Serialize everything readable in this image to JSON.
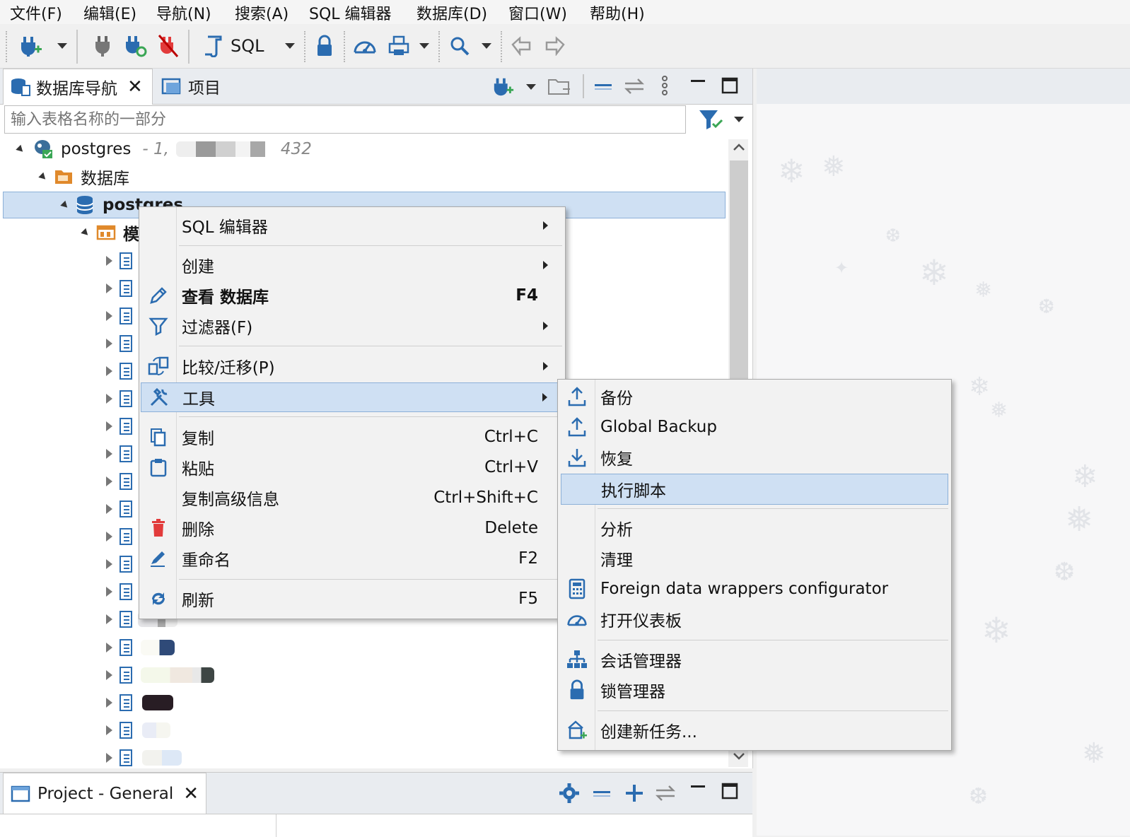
{
  "menubar": {
    "items": [
      "文件(F)",
      "编辑(E)",
      "导航(N)",
      "搜索(A)",
      "SQL 编辑器",
      "数据库(D)",
      "窗口(W)",
      "帮助(H)"
    ]
  },
  "toolbar": {
    "sql_label": "SQL"
  },
  "navigator": {
    "tabs": [
      {
        "label": "数据库导航",
        "active": true
      },
      {
        "label": "项目",
        "active": false
      }
    ],
    "filter_placeholder": "输入表格名称的一部分",
    "tree": {
      "connection_name": "postgres",
      "connection_detail": "- 1,",
      "connection_port": "432",
      "databases_folder": "数据库",
      "database_name": "postgres",
      "schema_prefix": "模"
    }
  },
  "context_menu": {
    "items": [
      {
        "label": "SQL 编辑器",
        "submenu": true,
        "icon": "none"
      },
      {
        "label": "创建",
        "submenu": true,
        "icon": "none"
      },
      {
        "label": "查看 数据库",
        "shortcut": "F4",
        "bold": true,
        "icon": "pencil-icon"
      },
      {
        "label": "过滤器(F)",
        "submenu": true,
        "icon": "filter-icon"
      },
      {
        "label": "比较/迁移(P)",
        "submenu": true,
        "icon": "compare-icon"
      },
      {
        "label": "工具",
        "submenu": true,
        "highlighted": true,
        "icon": "tools-icon"
      },
      {
        "label": "复制",
        "shortcut": "Ctrl+C",
        "icon": "copy-icon"
      },
      {
        "label": "粘贴",
        "shortcut": "Ctrl+V",
        "icon": "paste-icon"
      },
      {
        "label": "复制高级信息",
        "shortcut": "Ctrl+Shift+C",
        "icon": "none"
      },
      {
        "label": "删除",
        "shortcut": "Delete",
        "icon": "delete-icon"
      },
      {
        "label": "重命名",
        "shortcut": "F2",
        "icon": "rename-icon"
      },
      {
        "label": "刷新",
        "shortcut": "F5",
        "icon": "refresh-icon"
      }
    ]
  },
  "tools_submenu": {
    "items": [
      {
        "label": "备份",
        "icon": "upload-icon"
      },
      {
        "label": "Global Backup",
        "icon": "upload-icon"
      },
      {
        "label": "恢复",
        "icon": "download-icon"
      },
      {
        "label": "执行脚本",
        "highlighted": true,
        "icon": "none"
      },
      {
        "label": "分析",
        "icon": "none"
      },
      {
        "label": "清理",
        "icon": "none"
      },
      {
        "label": "Foreign data wrappers configurator",
        "icon": "calculator-icon"
      },
      {
        "label": "打开仪表板",
        "icon": "dashboard-icon"
      },
      {
        "label": "会话管理器",
        "icon": "session-icon"
      },
      {
        "label": "锁管理器",
        "icon": "lock-icon"
      },
      {
        "label": "创建新任务...",
        "icon": "task-icon"
      }
    ]
  },
  "bottom_panel": {
    "tab_label": "Project - General"
  },
  "colors": {
    "selection": "#cfe0f3",
    "accent_blue": "#2b6cb0",
    "folder_orange": "#e0892b"
  }
}
